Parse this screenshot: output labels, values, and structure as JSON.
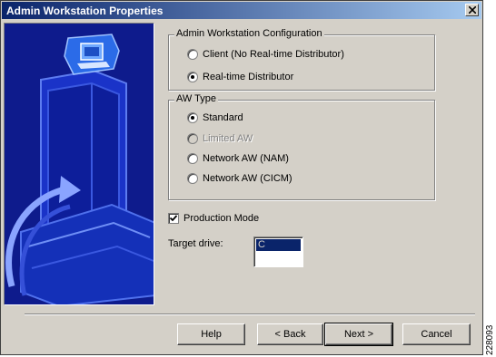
{
  "window": {
    "title": "Admin Workstation Properties"
  },
  "config_group": {
    "legend": "Admin Workstation Configuration",
    "options": [
      {
        "label": "Client (No Real-time Distributor)",
        "selected": false,
        "disabled": false
      },
      {
        "label": "Real-time Distributor",
        "selected": true,
        "disabled": false
      }
    ]
  },
  "aw_type_group": {
    "legend": "AW Type",
    "options": [
      {
        "label": "Standard",
        "selected": true,
        "disabled": false
      },
      {
        "label": "Limited AW",
        "selected": false,
        "disabled": true
      },
      {
        "label": "Network AW (NAM)",
        "selected": false,
        "disabled": false
      },
      {
        "label": "Network AW (CICM)",
        "selected": false,
        "disabled": false
      }
    ]
  },
  "production_mode": {
    "label": "Production Mode",
    "checked": true
  },
  "target_drive": {
    "label": "Target drive:",
    "items": [
      "C"
    ],
    "selected": "C"
  },
  "buttons": {
    "help": "Help",
    "back": "< Back",
    "next": "Next >",
    "cancel": "Cancel"
  },
  "side_code": "228093",
  "colors": {
    "titlebar_start": "#0a246a",
    "titlebar_end": "#a6caf0",
    "banner": "#0e1b8c",
    "face": "#d4d0c8"
  }
}
